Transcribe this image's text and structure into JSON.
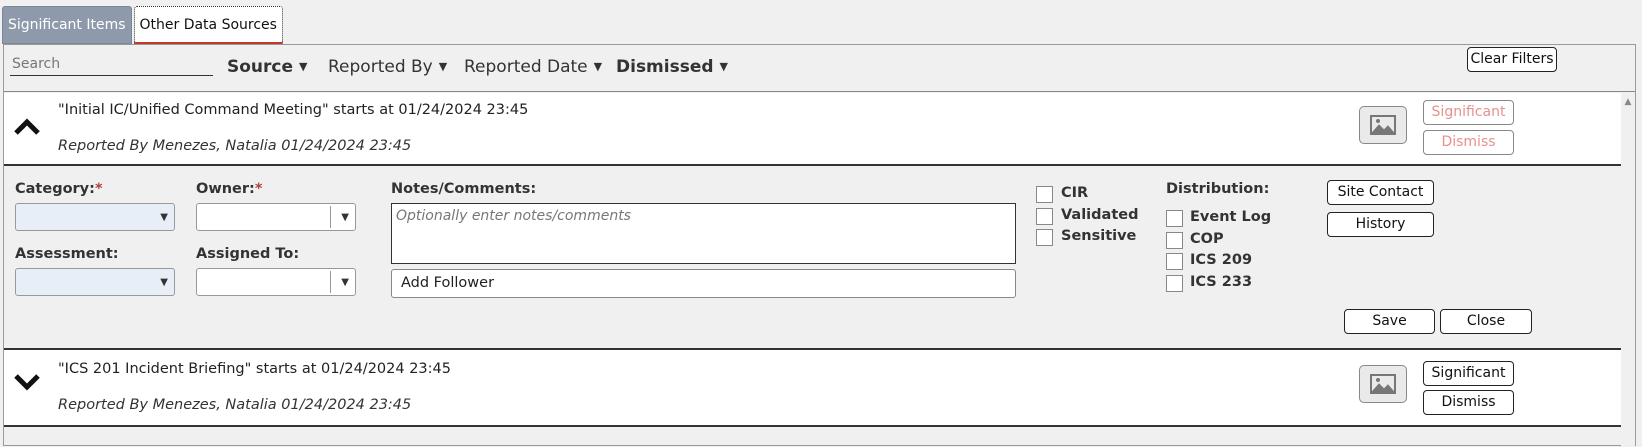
{
  "tabs": [
    {
      "label": "Significant Items"
    },
    {
      "label": "Other Data Sources"
    }
  ],
  "filters": {
    "search_placeholder": "Search",
    "source": "Source",
    "reported_by": "Reported By",
    "reported_date": "Reported Date",
    "dismissed": "Dismissed",
    "clear": "Clear Filters"
  },
  "items": [
    {
      "title": "\"Initial IC/Unified Command Meeting\" starts at 01/24/2024 23:45",
      "reported": "Reported By Menezes, Natalia 01/24/2024 23:45",
      "significant_label": "Significant",
      "dismiss_label": "Dismiss",
      "expanded": true
    },
    {
      "title": "\"ICS 201 Incident Briefing\" starts at 01/24/2024 23:45",
      "reported": "Reported By Menezes, Natalia 01/24/2024 23:45",
      "significant_label": "Significant",
      "dismiss_label": "Dismiss",
      "expanded": false
    }
  ],
  "details": {
    "category_label": "Category:",
    "owner_label": "Owner:",
    "required_mark": "*",
    "assessment_label": "Assessment:",
    "assigned_to_label": "Assigned To:",
    "notes_label": "Notes/Comments:",
    "notes_placeholder": "Optionally enter notes/comments",
    "add_follower": "Add Follower",
    "flags": [
      "CIR",
      "Validated",
      "Sensitive"
    ],
    "distribution_label": "Distribution:",
    "distribution": [
      "Event Log",
      "COP",
      "ICS 209",
      "ICS 233"
    ],
    "site_contact": "Site Contact",
    "history": "History",
    "save": "Save",
    "close": "Close"
  },
  "colors": {
    "tab_inactive": "#8e9aab",
    "accent_red": "#c0392b",
    "faded_red": "#e89090"
  }
}
